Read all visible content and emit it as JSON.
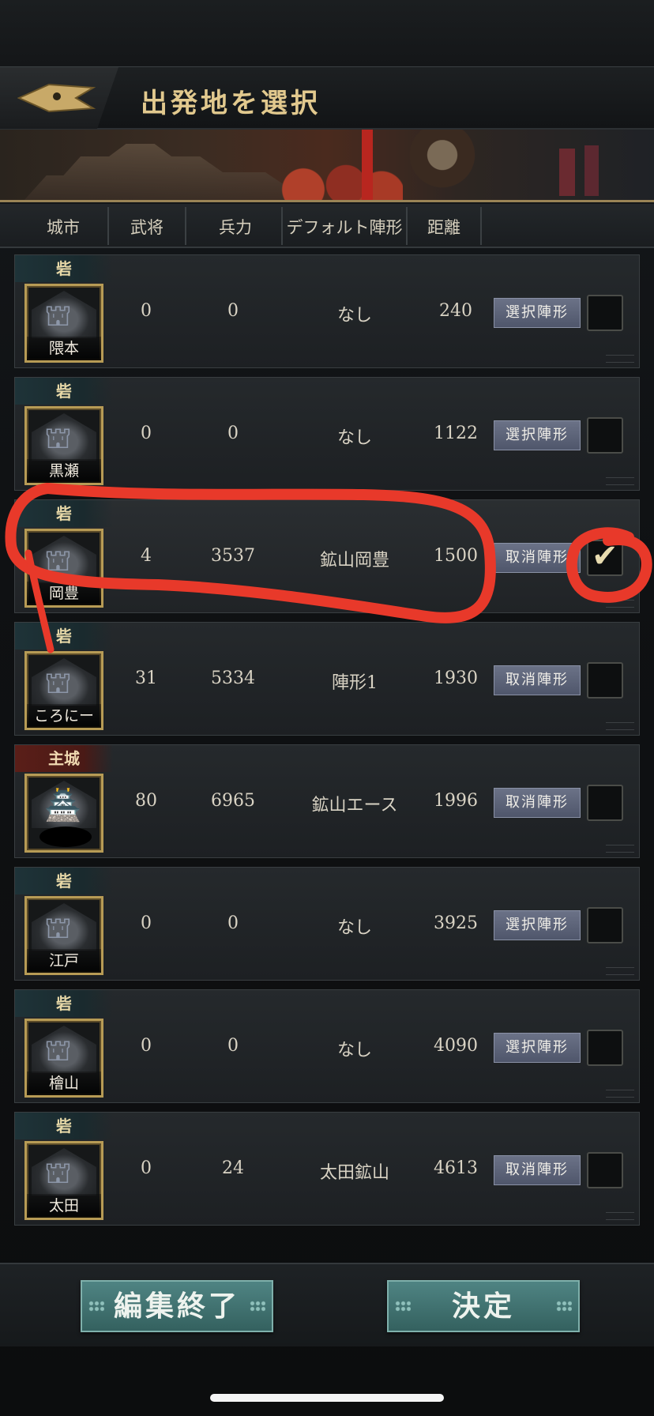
{
  "header": {
    "title": "出発地を選択"
  },
  "columns": {
    "city": "城市",
    "generals": "武将",
    "troops": "兵力",
    "default_formation": "デフォルト陣形",
    "distance": "距離"
  },
  "rows": [
    {
      "type": "砦",
      "name": "隈本",
      "generals": "0",
      "troops": "0",
      "formation": "なし",
      "distance": "240",
      "button": "選択陣形",
      "checked": false
    },
    {
      "type": "砦",
      "name": "黒瀬",
      "generals": "0",
      "troops": "0",
      "formation": "なし",
      "distance": "1122",
      "button": "選択陣形",
      "checked": false
    },
    {
      "type": "砦",
      "name": "岡豊",
      "generals": "4",
      "troops": "3537",
      "formation": "鉱山岡豊",
      "distance": "1500",
      "button": "取消陣形",
      "checked": true
    },
    {
      "type": "砦",
      "name": "ころにー",
      "generals": "31",
      "troops": "5334",
      "formation": "陣形1",
      "distance": "1930",
      "button": "取消陣形",
      "checked": false
    },
    {
      "type": "主城",
      "name": "",
      "generals": "80",
      "troops": "6965",
      "formation": "鉱山エース",
      "distance": "1996",
      "button": "取消陣形",
      "checked": false
    },
    {
      "type": "砦",
      "name": "江戸",
      "generals": "0",
      "troops": "0",
      "formation": "なし",
      "distance": "3925",
      "button": "選択陣形",
      "checked": false
    },
    {
      "type": "砦",
      "name": "檜山",
      "generals": "0",
      "troops": "0",
      "formation": "なし",
      "distance": "4090",
      "button": "選択陣形",
      "checked": false
    },
    {
      "type": "砦",
      "name": "太田",
      "generals": "0",
      "troops": "24",
      "formation": "太田鉱山",
      "distance": "4613",
      "button": "取消陣形",
      "checked": false
    }
  ],
  "footer": {
    "end_edit": "編集終了",
    "confirm": "決定"
  },
  "colors": {
    "accent_gold": "#e2c98e",
    "annotation_red": "#e8392a",
    "button_teal": "#3f706e"
  },
  "icons": {
    "back": "arrowhead-back-icon",
    "castle": "castle-icon",
    "check": "check-icon"
  }
}
